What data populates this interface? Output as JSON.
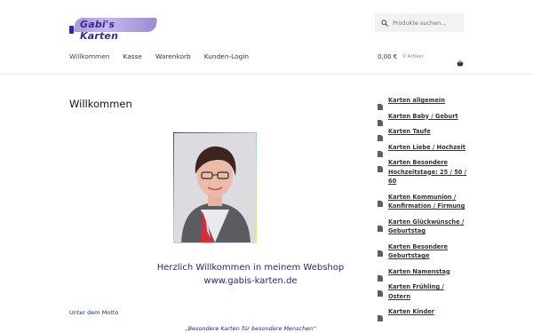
{
  "logo": {
    "text": "Gabi's Karten"
  },
  "search": {
    "placeholder": "Produkte suchen…"
  },
  "nav": {
    "items": [
      "Willkommen",
      "Kasse",
      "Warenkorb",
      "Kunden-Login"
    ]
  },
  "cart": {
    "amount": "0,00 €",
    "count": "0 Artikel"
  },
  "main": {
    "title": "Willkommen",
    "welcome_line1": "Herzlich Willkommen in meinem Webshop",
    "welcome_line2": "www.gabis-karten.de",
    "motto_label": "Unter dem Motto",
    "motto": "„Besondere Karten für besondere Menschen“"
  },
  "sidebar": {
    "categories": [
      "Karten allgemein",
      "Karten Baby / Geburt",
      "Karten Taufe",
      "Karten Liebe / Hochzeit",
      "Karten Besondere Hochzeitstage: 25 / 50 / 60",
      "Karten Kommunion / Konfirmation / Firmung",
      "Karten Glückwünsche / Geburtstag",
      "Karten Besondere Geburtstage",
      "Karten Namenstag",
      "Karten Frühling / Ostern",
      "Karten Kinder"
    ]
  },
  "colors": {
    "accent": "#1c2a8a",
    "search_bg": "#f2f2f2"
  }
}
